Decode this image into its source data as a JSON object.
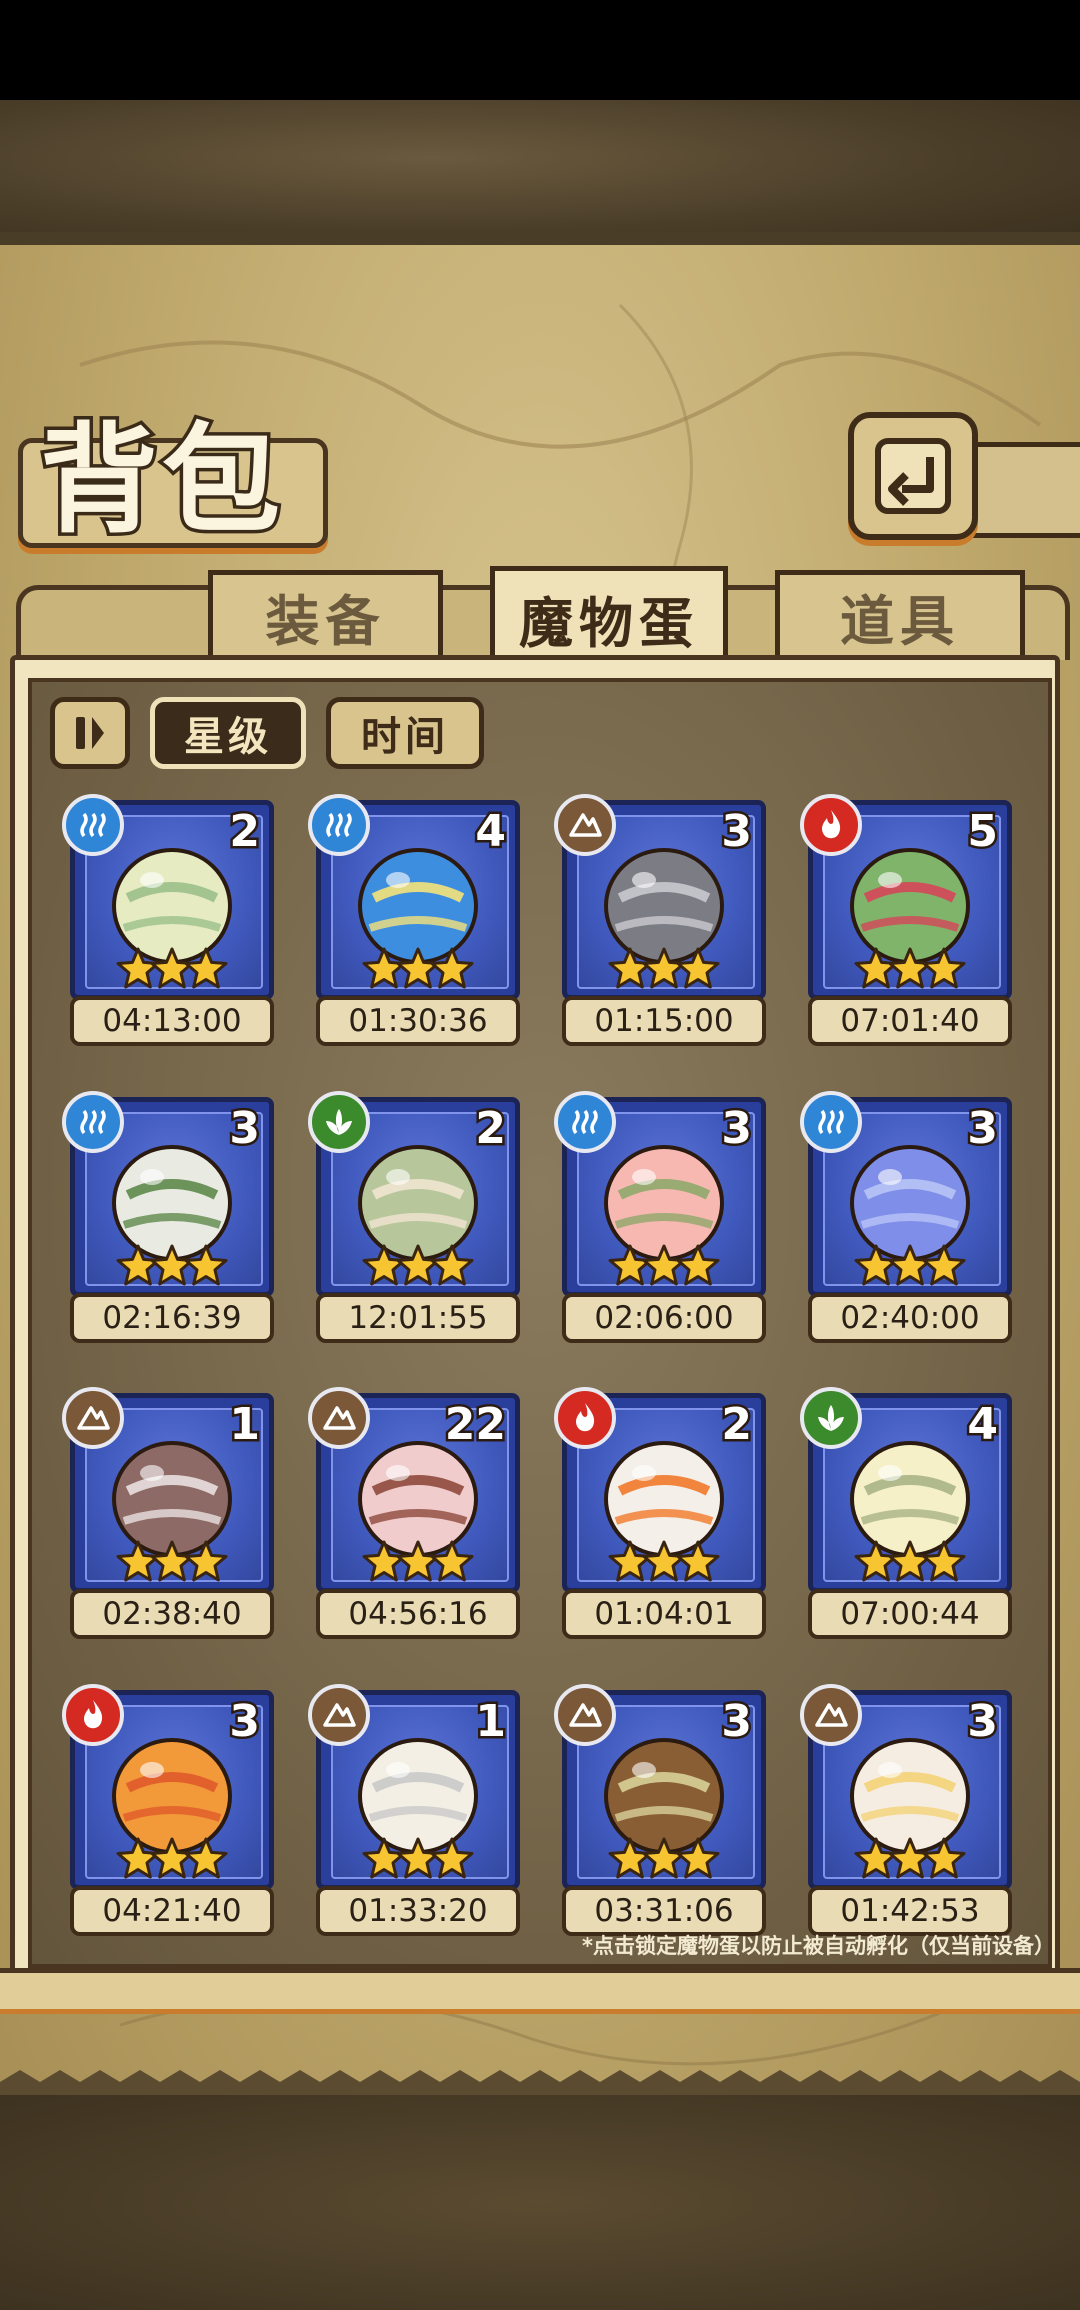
{
  "header": {
    "title": "背包",
    "back_icon": "back-arrow-icon"
  },
  "tabs": [
    {
      "label": "装备",
      "active": false
    },
    {
      "label": "魔物蛋",
      "active": true
    },
    {
      "label": "道具",
      "active": false
    }
  ],
  "controls": {
    "pause_icon": "pause-icon",
    "sort_star": "星级",
    "sort_time": "时间",
    "active_sort": "星级"
  },
  "elements": {
    "water": "#2f86d6",
    "earth": "#7a5838",
    "fire": "#d42a22",
    "nature": "#3b8a2c"
  },
  "eggs": [
    {
      "element": "water",
      "count": "2",
      "stars": 3,
      "time": "04:13:00",
      "art": "striped-egg-icon"
    },
    {
      "element": "water",
      "count": "4",
      "stars": 3,
      "time": "01:30:36",
      "art": "blue-eye-blob-icon"
    },
    {
      "element": "earth",
      "count": "3",
      "stars": 3,
      "time": "01:15:00",
      "art": "cleaver-icon"
    },
    {
      "element": "fire",
      "count": "5",
      "stars": 3,
      "time": "07:01:40",
      "art": "cactus-egg-icon"
    },
    {
      "element": "water",
      "count": "3",
      "stars": 3,
      "time": "02:16:39",
      "art": "skull-egg-icon"
    },
    {
      "element": "nature",
      "count": "2",
      "stars": 3,
      "time": "12:01:55",
      "art": "leaf-pod-icon"
    },
    {
      "element": "water",
      "count": "3",
      "stars": 3,
      "time": "02:06:00",
      "art": "peach-icon"
    },
    {
      "element": "water",
      "count": "3",
      "stars": 3,
      "time": "02:40:00",
      "art": "crystal-bottle-icon"
    },
    {
      "element": "earth",
      "count": "1",
      "stars": 3,
      "time": "02:38:40",
      "art": "book-icon"
    },
    {
      "element": "earth",
      "count": "22",
      "stars": 3,
      "time": "04:56:16",
      "art": "gift-pouch-icon"
    },
    {
      "element": "fire",
      "count": "2",
      "stars": 3,
      "time": "01:04:01",
      "art": "flame-horn-egg-icon"
    },
    {
      "element": "nature",
      "count": "4",
      "stars": 3,
      "time": "07:00:44",
      "art": "lotus-egg-icon"
    },
    {
      "element": "fire",
      "count": "3",
      "stars": 3,
      "time": "04:21:40",
      "art": "fire-swirl-icon"
    },
    {
      "element": "earth",
      "count": "1",
      "stars": 3,
      "time": "01:33:20",
      "art": "fluffy-horn-egg-icon"
    },
    {
      "element": "earth",
      "count": "3",
      "stars": 3,
      "time": "03:31:06",
      "art": "acorn-pot-icon"
    },
    {
      "element": "earth",
      "count": "3",
      "stars": 3,
      "time": "01:42:53",
      "art": "fluffy-ghost-icon"
    }
  ],
  "footer_note": "*点击锁定魔物蛋以防止被自动孵化（仅当前设备）"
}
